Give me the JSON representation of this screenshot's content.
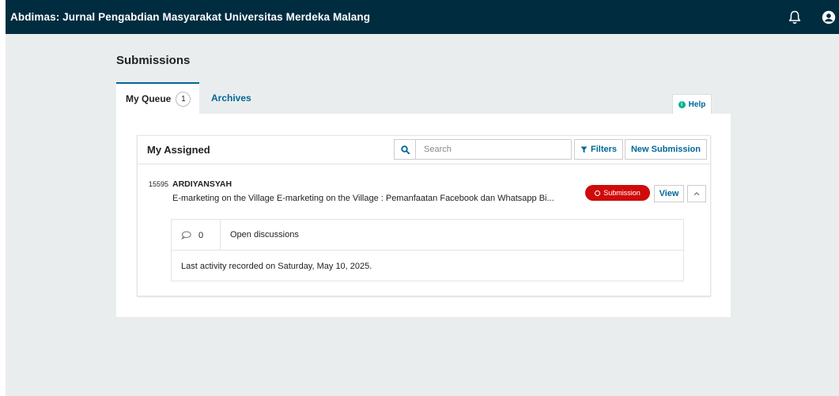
{
  "header": {
    "site_title": "Abdimas: Jurnal Pengabdian Masyarakat Universitas Merdeka Malang",
    "icons": [
      "bell-icon",
      "user-icon"
    ]
  },
  "page": {
    "title": "Submissions"
  },
  "tabs": {
    "queue_label": "My Queue",
    "queue_count": "1",
    "archives_label": "Archives",
    "help_label": "Help"
  },
  "list": {
    "title": "My Assigned",
    "search_placeholder": "Search",
    "filters_label": "Filters",
    "new_submission_label": "New Submission"
  },
  "submission": {
    "id": "15595",
    "author": "ARDIYANSYAH",
    "title": "E-marketing on the Village E-marketing on the Village : Pemanfaatan Facebook dan Whatsapp Bi...",
    "stage": "Submission",
    "view_label": "View",
    "discussion_count": "0",
    "discussion_label": "Open discussions",
    "last_activity": "Last activity recorded on Saturday, May 10, 2025."
  },
  "colors": {
    "header_bg": "#002c40",
    "link": "#006798",
    "badge_red": "#d00a0a",
    "help_green": "#00b28d"
  }
}
